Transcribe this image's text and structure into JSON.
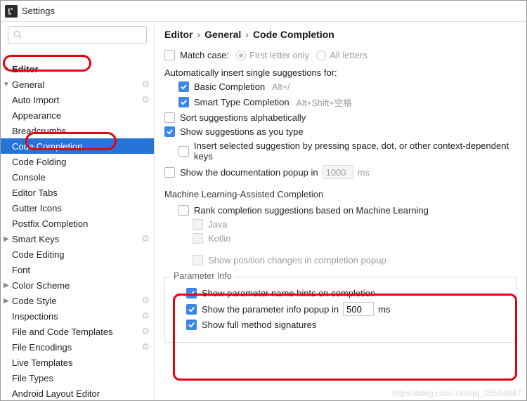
{
  "window": {
    "title_icon": "intellij-icon",
    "title": "Settings"
  },
  "search": {
    "placeholder": ""
  },
  "sidebar": {
    "cutoff_label": "",
    "editor_label": "Editor",
    "general_label": "General",
    "items_general": {
      "auto_import": "Auto Import",
      "appearance": "Appearance",
      "breadcrumbs": "Breadcrumbs",
      "code_completion": "Code Completion",
      "code_folding": "Code Folding",
      "console": "Console",
      "editor_tabs": "Editor Tabs",
      "gutter_icons": "Gutter Icons",
      "postfix_completion": "Postfix Completion",
      "smart_keys": "Smart Keys"
    },
    "code_editing": "Code Editing",
    "font": "Font",
    "color_scheme": "Color Scheme",
    "code_style": "Code Style",
    "inspections": "Inspections",
    "file_and_code_templates": "File and Code Templates",
    "file_encodings": "File Encodings",
    "live_templates": "Live Templates",
    "file_types": "File Types",
    "android_layout_editor": "Android Layout Editor"
  },
  "breadcrumb": {
    "a": "Editor",
    "b": "General",
    "c": "Code Completion"
  },
  "main": {
    "match_case": "Match case:",
    "first_letter_only": "First letter only",
    "all_letters": "All letters",
    "auto_insert_header": "Automatically insert single suggestions for:",
    "basic_completion": "Basic Completion",
    "basic_hint": "Alt+/",
    "smart_type_completion": "Smart Type Completion",
    "smart_type_hint": "Alt+Shift+空格",
    "sort_alpha": "Sort suggestions alphabetically",
    "show_as_you_type": "Show suggestions as you type",
    "insert_selected": "Insert selected suggestion by pressing space, dot, or other context-dependent keys",
    "show_doc_in": "Show the documentation popup in",
    "show_doc_value": "1000",
    "ms": "ms",
    "ml_header": "Machine Learning-Assisted Completion",
    "ml_rank": "Rank completion suggestions based on Machine Learning",
    "ml_java": "Java",
    "ml_kotlin": "Kotlin",
    "ml_show_changes": "Show position changes in completion popup",
    "param_info_header": "Parameter Info",
    "param_hints": "Show parameter name hints on completion",
    "param_popup_in": "Show the parameter info popup in",
    "param_popup_value": "500",
    "param_full_sig": "Show full method signatures"
  },
  "watermark": "https://blog.csdn.net/qq_16504847"
}
